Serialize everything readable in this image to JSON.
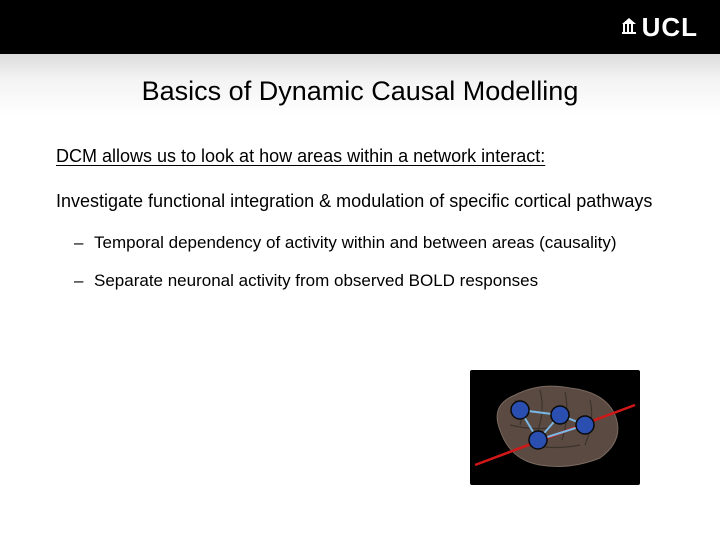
{
  "header": {
    "logo_text": "UCL"
  },
  "title": "Basics of Dynamic Causal Modelling",
  "intro": "DCM allows us to look at how areas within a network interact:",
  "description": "Investigate functional integration & modulation of specific cortical pathways",
  "bullets": [
    "Temporal dependency of activity within and between areas (causality)",
    "Separate neuronal activity from observed BOLD responses"
  ],
  "figure": {
    "alt": "brain-network-diagram"
  }
}
